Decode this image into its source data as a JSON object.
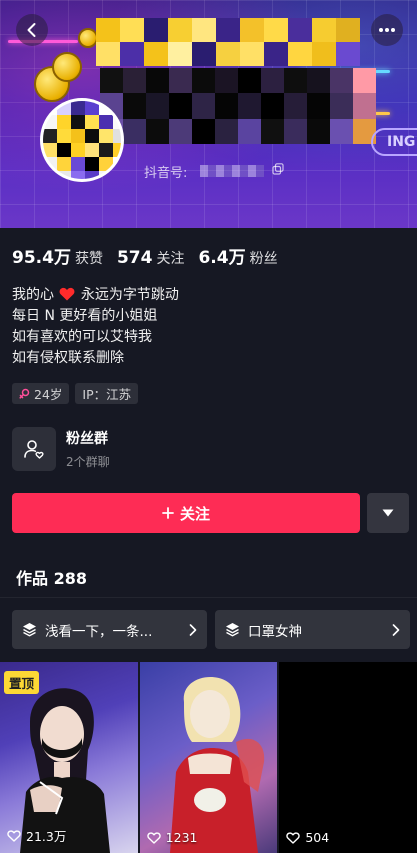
{
  "header": {
    "douyin_id_label": "抖音号:",
    "ing_tag": "ING"
  },
  "stats": [
    {
      "value": "95.4万",
      "label": "获赞"
    },
    {
      "value": "574",
      "label": "关注"
    },
    {
      "value": "6.4万",
      "label": "粉丝"
    }
  ],
  "bio": {
    "line1_pre": "我的心",
    "line1_post": "永远为字节跳动",
    "line2": "每日 N 更好看的小姐姐",
    "line3": "如有喜欢的可以艾特我",
    "line4": "如有侵权联系删除"
  },
  "tags": {
    "age": "24岁",
    "ip": "IP：江苏"
  },
  "fan_group": {
    "title": "粉丝群",
    "subtitle": "2个群聊"
  },
  "actions": {
    "follow_label": "关注",
    "follow_plus": "+"
  },
  "works": {
    "label": "作品",
    "count": "288"
  },
  "collections": [
    {
      "label": "浅看一下，一条..."
    },
    {
      "label": "口罩女神"
    }
  ],
  "videos": [
    {
      "pinned_label": "置顶",
      "likes": "21.3万"
    },
    {
      "likes": "1231"
    },
    {
      "likes": "504"
    }
  ],
  "colors": {
    "accent": "#fe2c55",
    "background": "#161823",
    "pin_badge": "#fdd835"
  },
  "icons": [
    "back-arrow-icon",
    "more-icon",
    "copy-icon",
    "female-icon",
    "fan-group-icon",
    "plus-icon",
    "caret-down-icon",
    "layers-icon",
    "chevron-right-icon",
    "heart-icon"
  ]
}
